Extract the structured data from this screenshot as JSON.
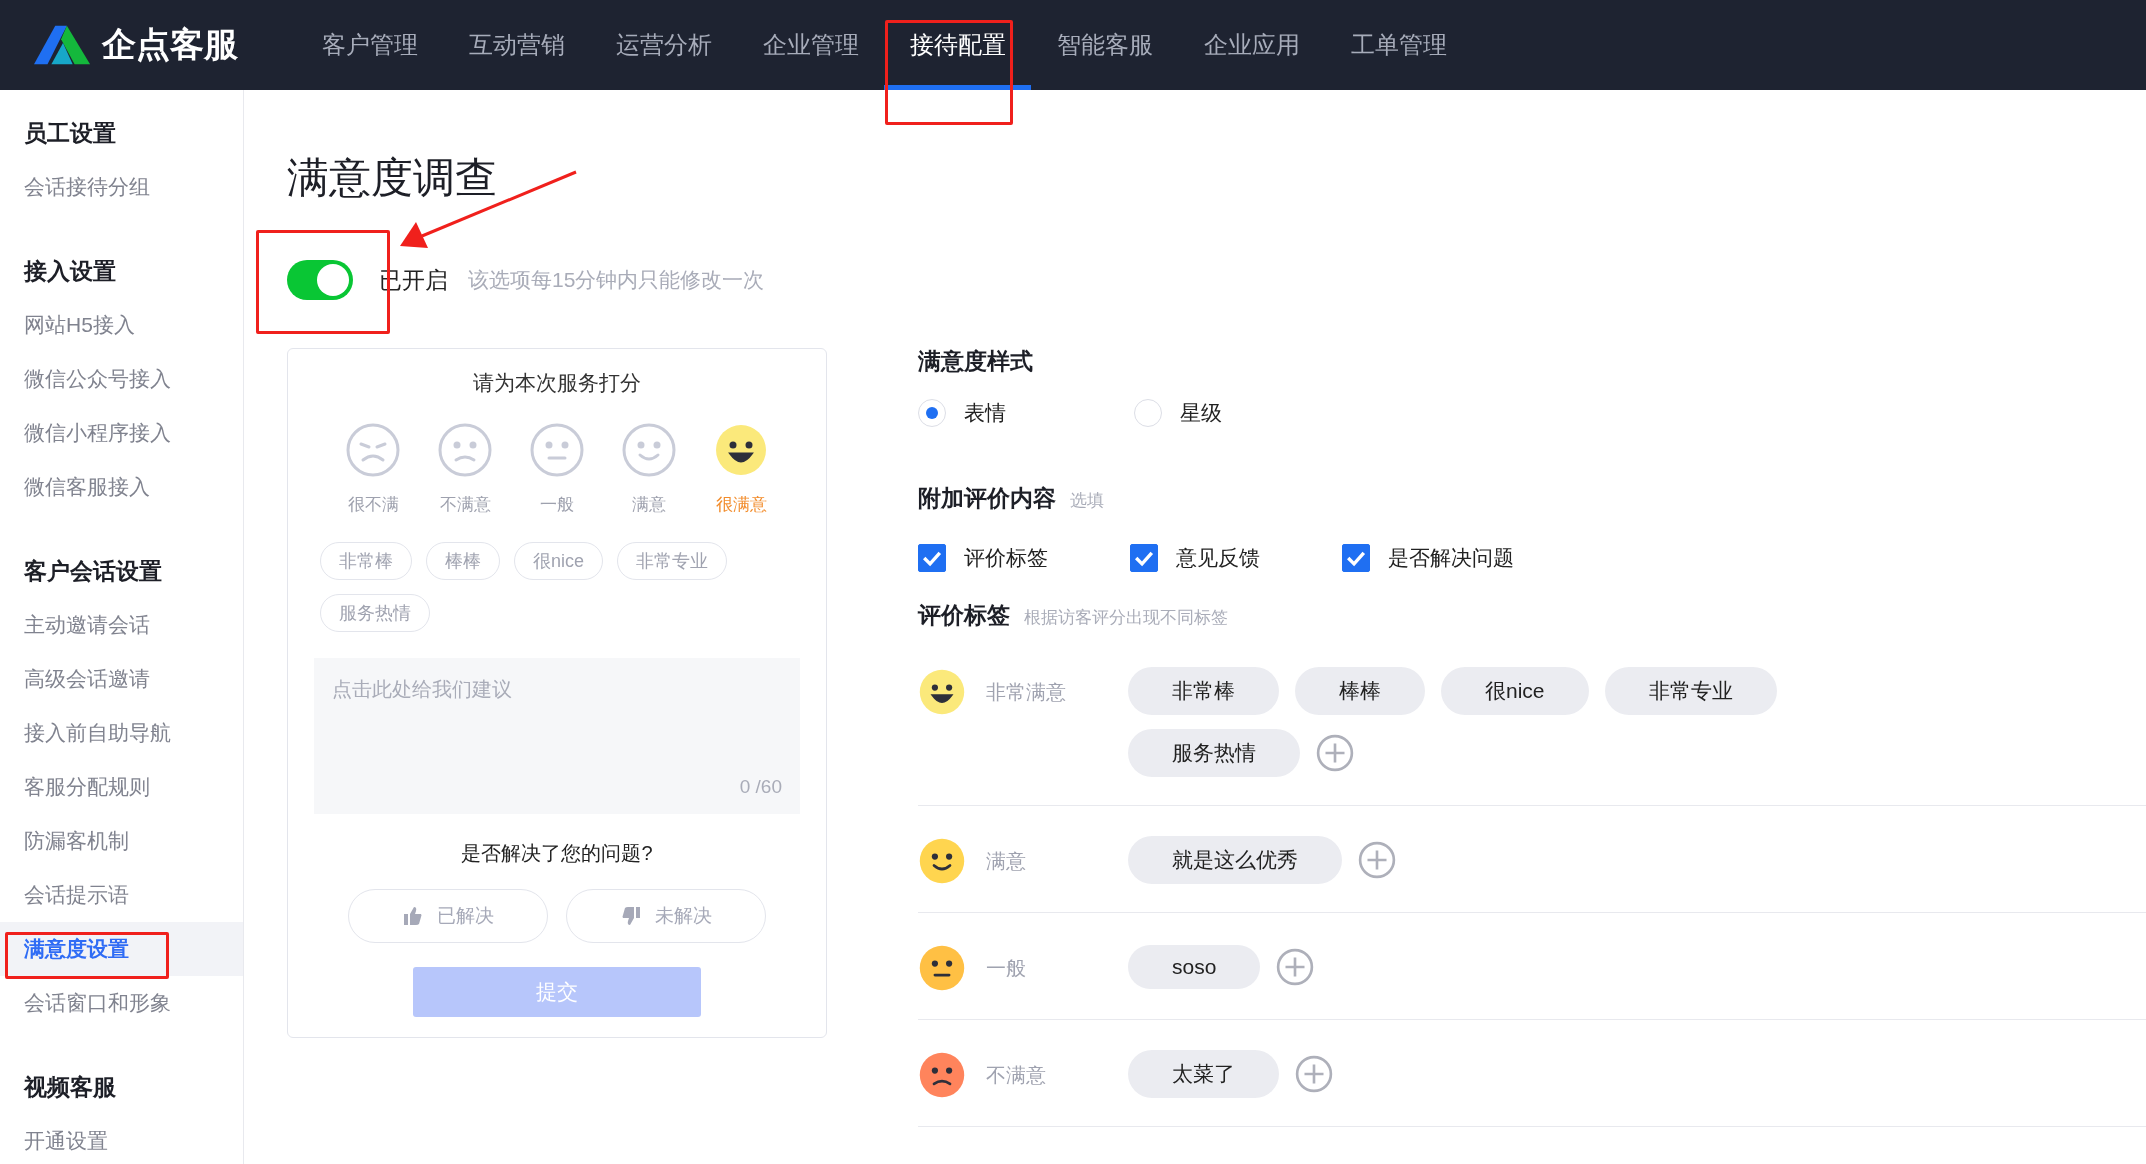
{
  "brand": {
    "name": "企点客服"
  },
  "nav": [
    {
      "label": "客户管理",
      "selected": false
    },
    {
      "label": "互动营销",
      "selected": false
    },
    {
      "label": "运营分析",
      "selected": false
    },
    {
      "label": "企业管理",
      "selected": false
    },
    {
      "label": "接待配置",
      "selected": true
    },
    {
      "label": "智能客服",
      "selected": false
    },
    {
      "label": "企业应用",
      "selected": false
    },
    {
      "label": "工单管理",
      "selected": false
    }
  ],
  "sidebar": [
    {
      "heading": "员工设置",
      "items": [
        {
          "label": "会话接待分组",
          "selected": false
        }
      ]
    },
    {
      "heading": "接入设置",
      "items": [
        {
          "label": "网站H5接入",
          "selected": false
        },
        {
          "label": "微信公众号接入",
          "selected": false
        },
        {
          "label": "微信小程序接入",
          "selected": false
        },
        {
          "label": "微信客服接入",
          "selected": false
        }
      ]
    },
    {
      "heading": "客户会话设置",
      "items": [
        {
          "label": "主动邀请会话",
          "selected": false
        },
        {
          "label": "高级会话邀请",
          "selected": false
        },
        {
          "label": "接入前自助导航",
          "selected": false
        },
        {
          "label": "客服分配规则",
          "selected": false
        },
        {
          "label": "防漏客机制",
          "selected": false
        },
        {
          "label": "会话提示语",
          "selected": false
        },
        {
          "label": "满意度设置",
          "selected": true
        },
        {
          "label": "会话窗口和形象",
          "selected": false
        }
      ]
    },
    {
      "heading": "视频客服",
      "items": [
        {
          "label": "开通设置",
          "selected": false
        }
      ]
    }
  ],
  "page_title": "满意度调查",
  "toggle": {
    "on": true,
    "label": "已开启",
    "hint": "该选项每15分钟内只能修改一次"
  },
  "preview": {
    "prompt": "请为本次服务打分",
    "faces": [
      {
        "kind": "very_unsatisfied",
        "label": "很不满",
        "selected": false
      },
      {
        "kind": "unsatisfied",
        "label": "不满意",
        "selected": false
      },
      {
        "kind": "neutral",
        "label": "一般",
        "selected": false
      },
      {
        "kind": "satisfied",
        "label": "满意",
        "selected": false
      },
      {
        "kind": "very_satisfied",
        "label": "很满意",
        "selected": true
      }
    ],
    "tags": [
      "非常棒",
      "棒棒",
      "很nice",
      "非常专业",
      "服务热情"
    ],
    "feedback": {
      "placeholder": "点击此处给我们建议",
      "counter": "0 /60"
    },
    "question": "是否解决了您的问题?",
    "answers": [
      {
        "kind": "up",
        "label": "已解决"
      },
      {
        "kind": "down",
        "label": "未解决"
      }
    ],
    "submit": {
      "label": "提交",
      "disabled": true
    }
  },
  "style_section": {
    "title": "满意度样式",
    "options": [
      {
        "label": "表情",
        "selected": true
      },
      {
        "label": "星级",
        "selected": false
      }
    ]
  },
  "extra_section": {
    "title": "附加评价内容",
    "note": "选填",
    "options": [
      {
        "label": "评价标签",
        "checked": true
      },
      {
        "label": "意见反馈",
        "checked": true
      },
      {
        "label": "是否解决问题",
        "checked": true
      }
    ]
  },
  "tags_section": {
    "title": "评价标签",
    "note": "根据访客评分出现不同标签",
    "rows": [
      {
        "kind": "very_satisfied",
        "label": "非常满意",
        "color": "#fbe97b",
        "tags": [
          "非常棒",
          "棒棒",
          "很nice",
          "非常专业",
          "服务热情"
        ]
      },
      {
        "kind": "satisfied",
        "label": "满意",
        "color": "#ffd54f",
        "tags": [
          "就是这么优秀"
        ]
      },
      {
        "kind": "neutral",
        "label": "一般",
        "color": "#ffc044",
        "tags": [
          "soso"
        ]
      },
      {
        "kind": "unsatisfied",
        "label": "不满意",
        "color": "#ff845c",
        "tags": [
          "太菜了"
        ]
      }
    ]
  }
}
